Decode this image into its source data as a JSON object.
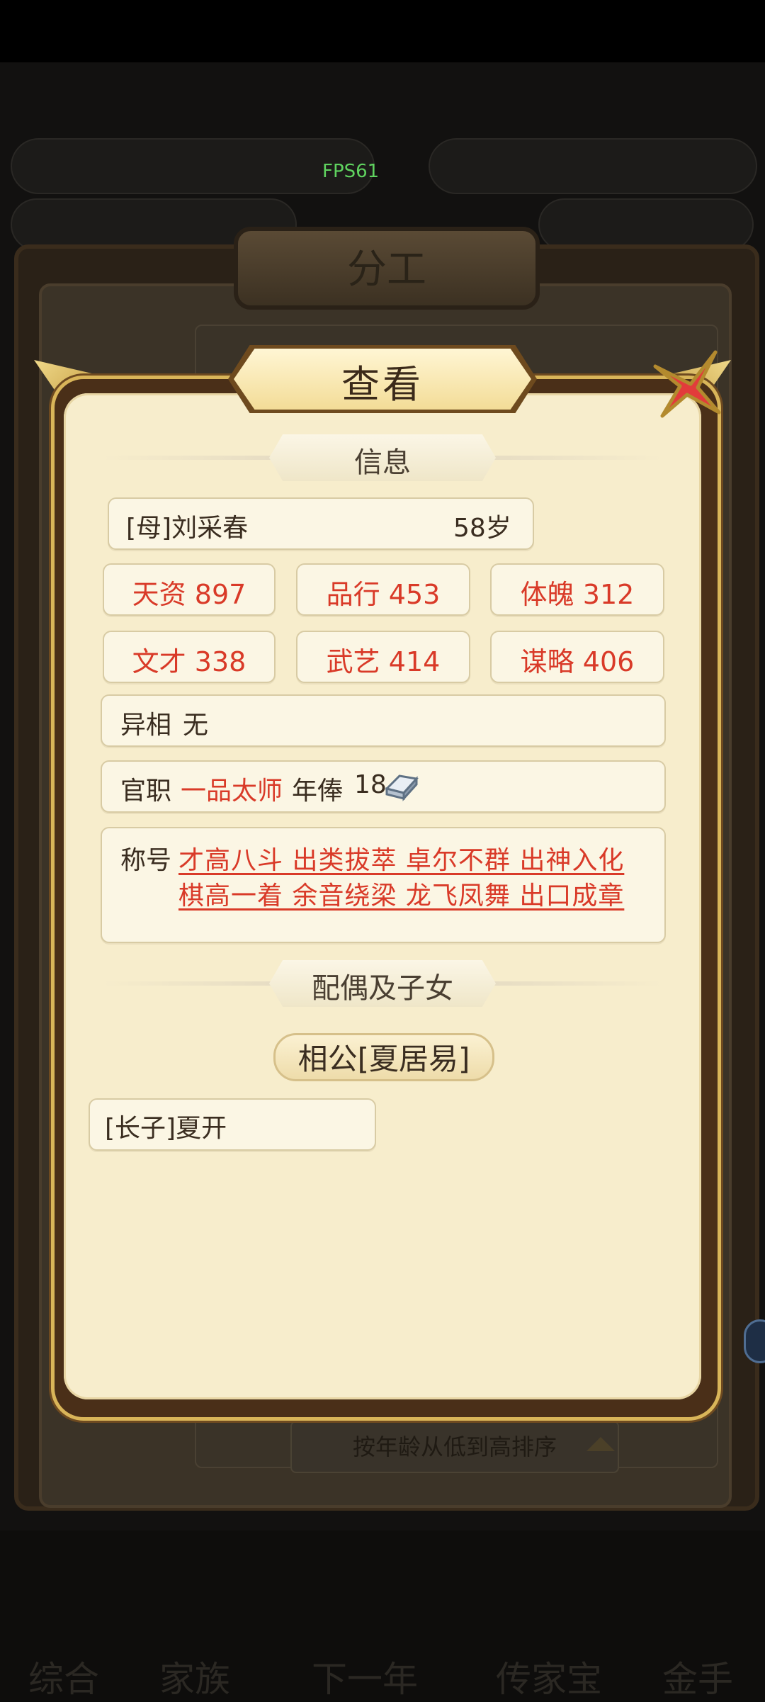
{
  "background": {
    "fps": "FPS61",
    "panel_title": "分工",
    "sort_label": "按年龄从低到高排序",
    "nav": [
      "综合",
      "家族",
      "下一年",
      "传家宝",
      "金手"
    ]
  },
  "dialog": {
    "title": "查看",
    "info_header": "信息",
    "person": {
      "name": "[母]刘采春",
      "age": "58岁"
    },
    "stats": [
      {
        "label": "天资",
        "value": "897"
      },
      {
        "label": "品行",
        "value": "453"
      },
      {
        "label": "体魄",
        "value": "312"
      },
      {
        "label": "文才",
        "value": "338"
      },
      {
        "label": "武艺",
        "value": "414"
      },
      {
        "label": "谋略",
        "value": "406"
      }
    ],
    "trait": {
      "label": "异相",
      "value": "无"
    },
    "office": {
      "label": "官职",
      "rank": "一品太师",
      "salary_label": "年俸",
      "salary_value": "18"
    },
    "honor": {
      "label": "称号",
      "line1": "才高八斗 出类拔萃 卓尔不群 出神入化",
      "line2": "棋高一着 余音绕梁 龙飞凤舞 出口成章"
    },
    "family_header": "配偶及子女",
    "spouse": "相公[夏居易]",
    "children": [
      "[长子]夏开"
    ]
  },
  "colors": {
    "accent_red": "#d93a28",
    "parchment": "#f7edcc",
    "frame_gold": "#d9b559"
  }
}
